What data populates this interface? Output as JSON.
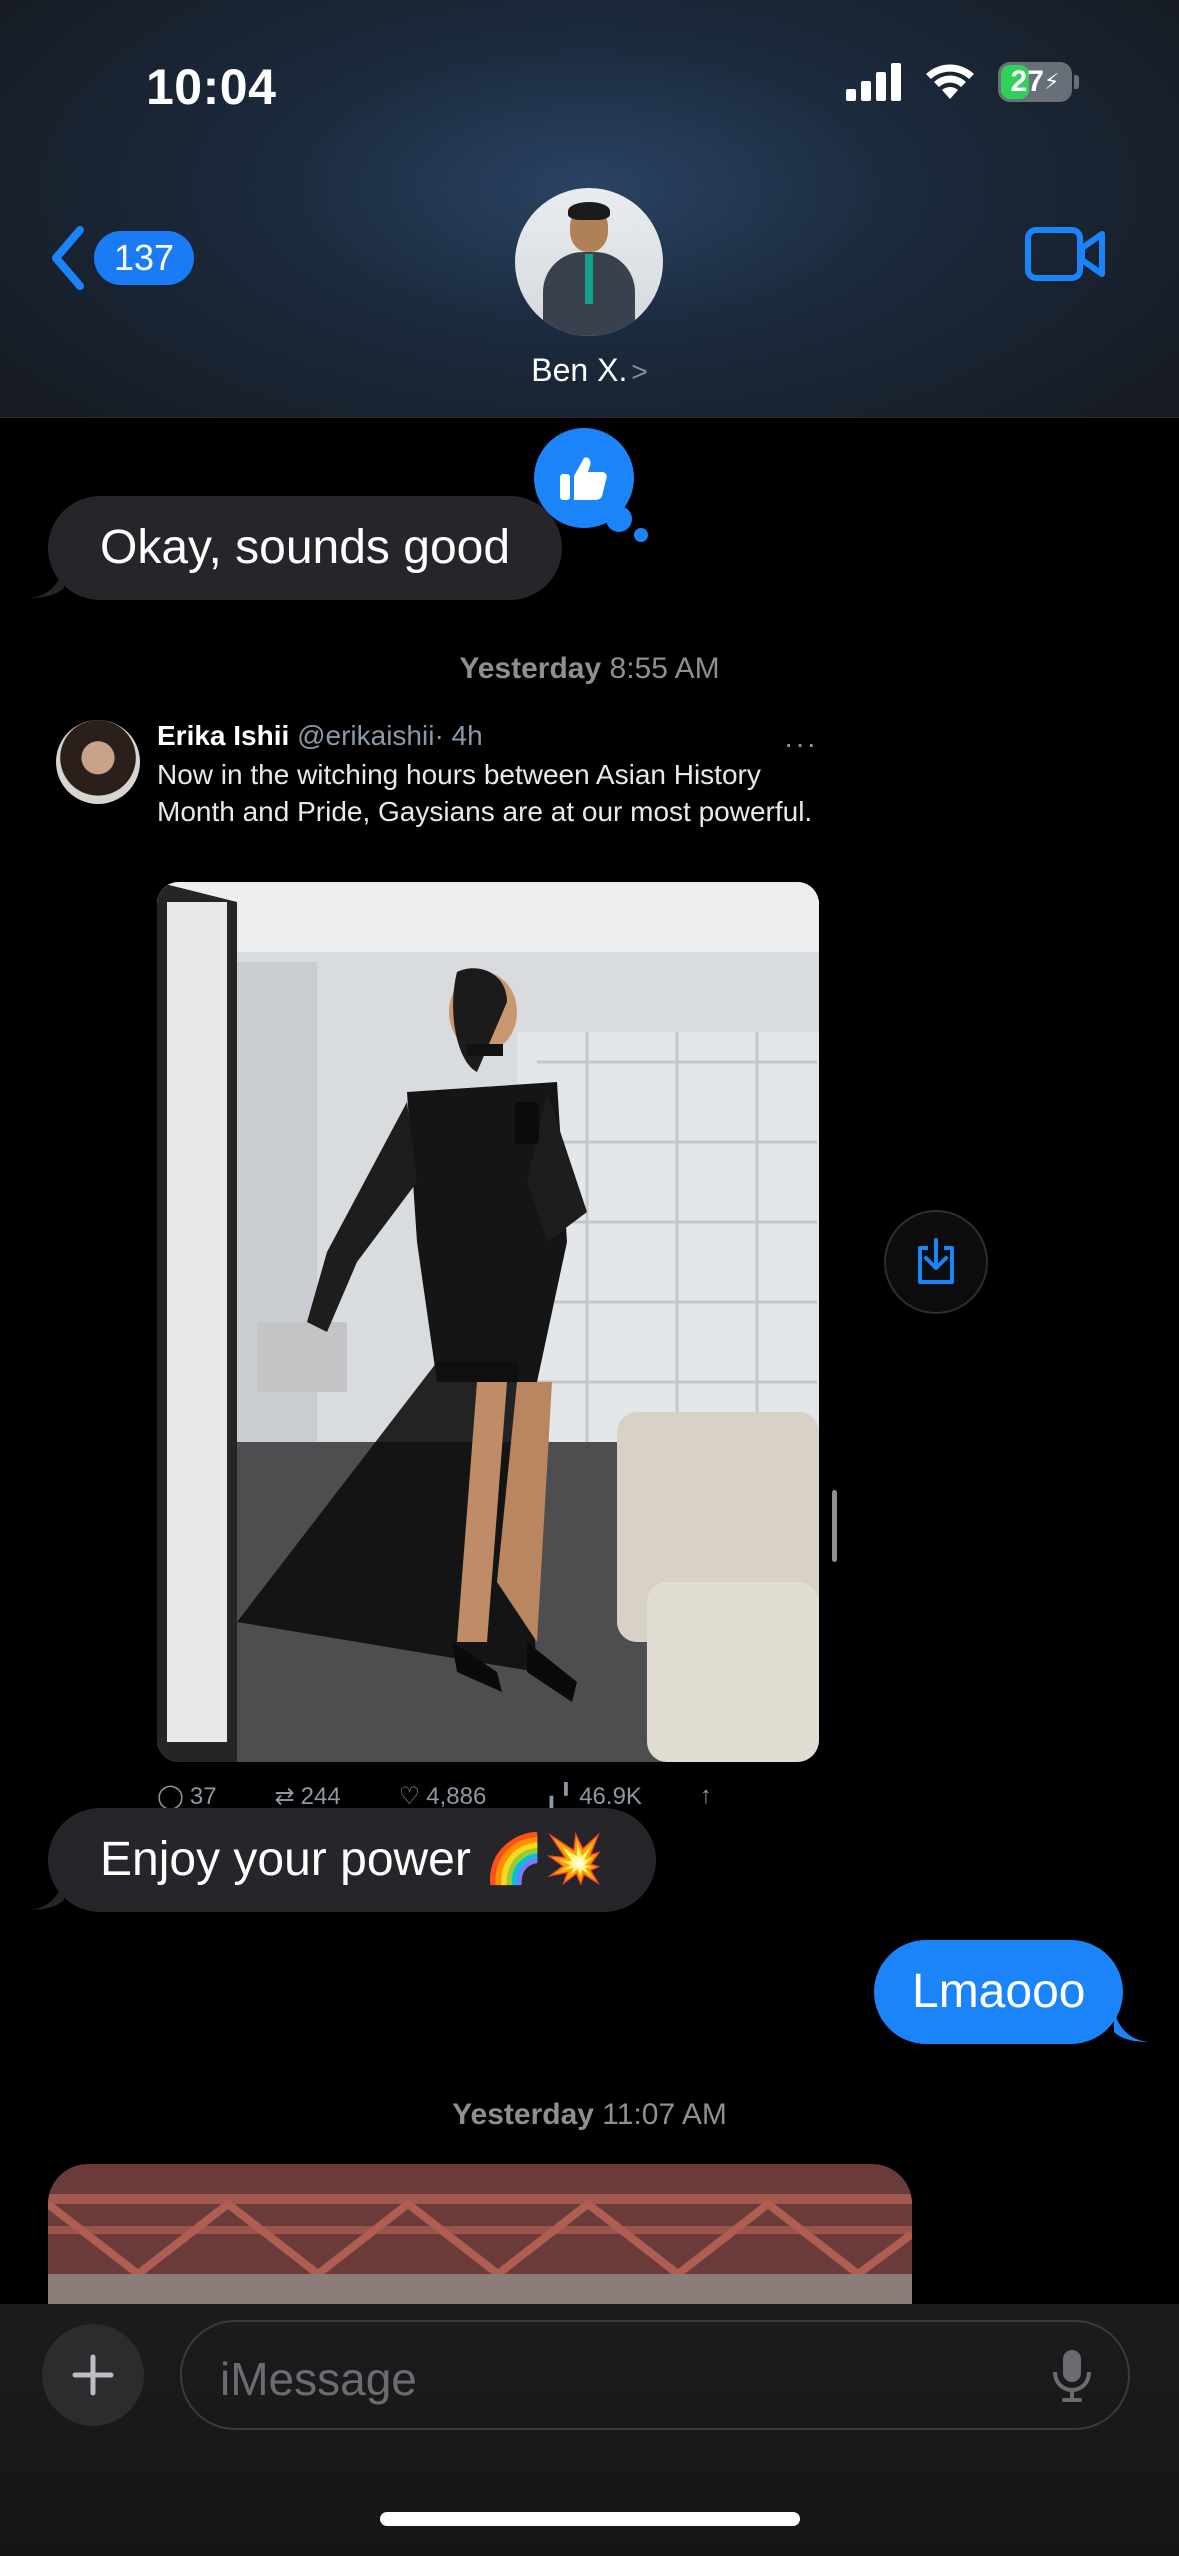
{
  "status_bar": {
    "time": "10:04",
    "battery": "27"
  },
  "header": {
    "back_count": "137",
    "contact_name": "Ben X.",
    "contact_chevron": ">"
  },
  "messages": {
    "msg1": "Okay, sounds good",
    "msg1_reaction": "thumbs-up",
    "timestamp1_day": "Yesterday",
    "timestamp1_time": "8:55 AM",
    "tweet": {
      "author_name": "Erika Ishii",
      "author_handle": "@erikaishii",
      "age": "· 4h",
      "more": "···",
      "text": "Now in the witching hours between Asian History Month and Pride, Gaysians are at our most powerful.",
      "replies": "37",
      "retweets": "244",
      "likes": "4,886",
      "views": "46.9K"
    },
    "msg2": "Enjoy your power 🌈💥",
    "msg3": "Lmaooo",
    "timestamp2_day": "Yesterday",
    "timestamp2_time": "11:07 AM"
  },
  "composer": {
    "placeholder": "iMessage"
  },
  "colors": {
    "accent": "#1a84f8",
    "incoming_bubble": "#26252a",
    "battery_green": "#30d158"
  }
}
